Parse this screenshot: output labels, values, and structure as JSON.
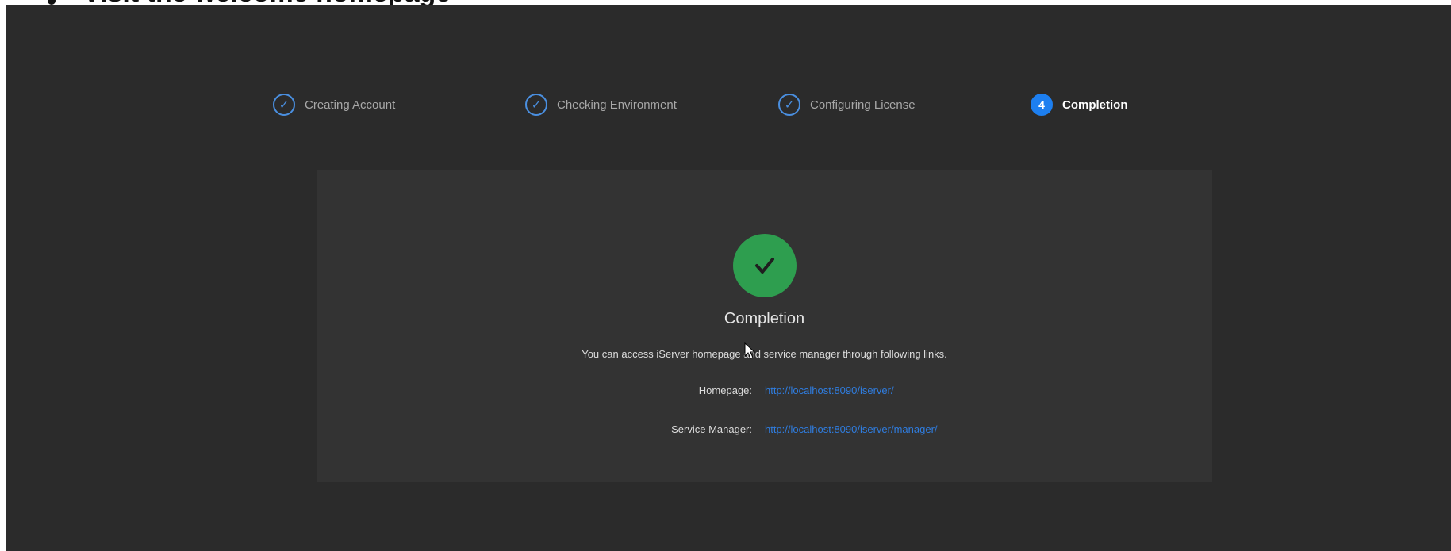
{
  "document": {
    "heading": "Visit the welcome homepage"
  },
  "stepper": {
    "steps": [
      {
        "label": "Creating Account",
        "state": "done",
        "icon": "check-icon"
      },
      {
        "label": "Checking Environment",
        "state": "done",
        "icon": "check-icon"
      },
      {
        "label": "Configuring License",
        "state": "done",
        "icon": "check-icon"
      },
      {
        "label": "Completion",
        "state": "active",
        "number": "4"
      }
    ]
  },
  "completion": {
    "icon": "success-check-icon",
    "title": "Completion",
    "description": "You can access iServer homepage and service manager through following links.",
    "links": [
      {
        "label": "Homepage:",
        "url": "http://localhost:8090/iserver/"
      },
      {
        "label": "Service Manager:",
        "url": "http://localhost:8090/iserver/manager/"
      }
    ]
  },
  "colors": {
    "background": "#2b2b2b",
    "card": "#333333",
    "accent": "#1d7ff0",
    "success": "#2e9e4f",
    "link": "#2f7de0"
  }
}
